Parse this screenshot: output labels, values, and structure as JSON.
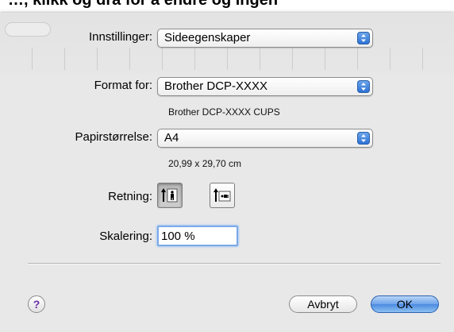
{
  "background_fragment": {
    "text": "…, klikk og dra for å endre og ingen"
  },
  "settings": {
    "label": "Innstillinger:",
    "value": "Sideegenskaper"
  },
  "format_for": {
    "label": "Format for:",
    "value": "Brother  DCP-XXXX",
    "subtitle": "Brother DCP-XXXX CUPS"
  },
  "paper_size": {
    "label": "Papirstørrelse:",
    "value": "A4",
    "dimensions": "20,99 x 29,70 cm"
  },
  "orientation": {
    "label": "Retning:",
    "options": [
      "portrait-icon",
      "landscape-icon"
    ],
    "selected": "portrait-icon"
  },
  "scaling": {
    "label": "Skalering:",
    "value": "100 %"
  },
  "buttons": {
    "help": "?",
    "cancel": "Avbryt",
    "ok": "OK"
  },
  "colors": {
    "accent": "#4b8ae0",
    "focus_ring": "#7aa9e8",
    "sheet_bg": "#e8e8e8",
    "help_icon": "#6b2fa8"
  }
}
